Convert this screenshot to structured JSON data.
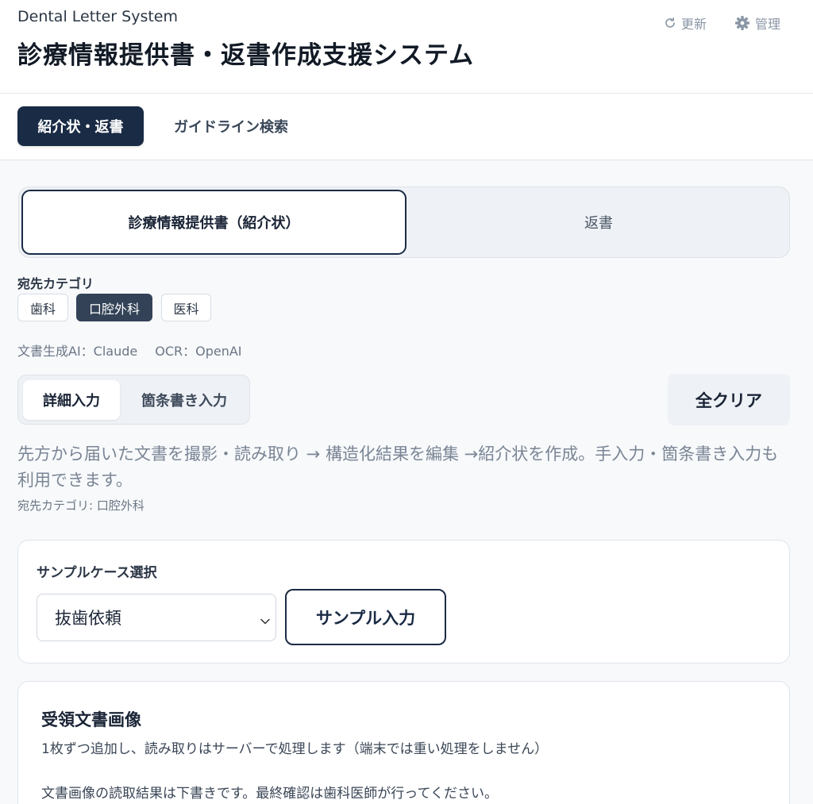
{
  "header": {
    "subtitle": "Dental Letter System",
    "title": "診療情報提供書・返書作成支援システム",
    "refresh_label": "更新",
    "admin_label": "管理"
  },
  "nav": {
    "tabs": [
      {
        "label": "紹介状・返書",
        "active": true
      },
      {
        "label": "ガイドライン検索",
        "active": false
      }
    ]
  },
  "document_type": {
    "options": [
      {
        "label": "診療情報提供書（紹介状）",
        "active": true
      },
      {
        "label": "返書",
        "active": false
      }
    ]
  },
  "destination": {
    "label": "宛先カテゴリ",
    "chips": [
      {
        "label": "歯科",
        "selected": false
      },
      {
        "label": "口腔外科",
        "selected": true
      },
      {
        "label": "医科",
        "selected": false
      }
    ]
  },
  "engines": {
    "doc_ai": "文書生成AI：Claude",
    "ocr": "OCR：OpenAI"
  },
  "input_mode": {
    "options": [
      {
        "label": "詳細入力",
        "active": true
      },
      {
        "label": "箇条書き入力",
        "active": false
      }
    ],
    "clear_label": "全クリア"
  },
  "description": {
    "text": "先方から届いた文書を撮影・読み取り → 構造化結果を編集 →紹介状を作成。手入力・箇条書き入力も利用できます。",
    "category": "宛先カテゴリ: 口腔外科"
  },
  "sample": {
    "label": "サンプルケース選択",
    "selected": "抜歯依頼",
    "button_label": "サンプル入力"
  },
  "received_images": {
    "title": "受領文書画像",
    "note1": "1枚ずつ追加し、読み取りはサーバーで処理します（端末では重い処理をしません）",
    "note2": "文書画像の読取結果は下書きです。最終確認は歯科医師が行ってください。"
  },
  "colors": {
    "primary": "#1a2b45",
    "chip_selected": "#334257",
    "muted_text": "#7a8594"
  }
}
